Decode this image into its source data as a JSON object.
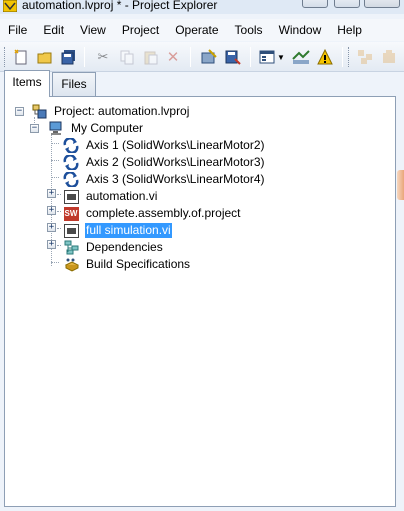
{
  "window": {
    "title": "automation.lvproj * - Project Explorer"
  },
  "menu": [
    "File",
    "Edit",
    "View",
    "Project",
    "Operate",
    "Tools",
    "Window",
    "Help"
  ],
  "toolbar": {
    "icons": [
      "new-icon",
      "open-icon",
      "save-all-icon",
      "cut-icon",
      "copy-icon",
      "paste-icon",
      "delete-icon",
      "build-icon",
      "save-build-icon",
      "view-icon",
      "dropdown-icon",
      "filter-icon",
      "warning-icon",
      "collapse-icon",
      "expand-icon"
    ]
  },
  "tabs": [
    {
      "label": "Items",
      "active": true
    },
    {
      "label": "Files",
      "active": false
    }
  ],
  "tree": {
    "project": "Project: automation.lvproj",
    "computer": "My Computer",
    "items": [
      {
        "label": "Axis 1 (SolidWorks\\LinearMotor2)",
        "icon": "axis-icon"
      },
      {
        "label": "Axis 2 (SolidWorks\\LinearMotor3)",
        "icon": "axis-icon"
      },
      {
        "label": "Axis 3 (SolidWorks\\LinearMotor4)",
        "icon": "axis-icon"
      },
      {
        "label": "automation.vi",
        "icon": "vi-icon"
      },
      {
        "label": "complete.assembly.of.project",
        "icon": "solidworks-icon"
      },
      {
        "label": "full simulation.vi",
        "icon": "vi-icon",
        "selected": true
      },
      {
        "label": "Dependencies",
        "icon": "dependencies-icon"
      },
      {
        "label": "Build Specifications",
        "icon": "build-specifications-icon"
      }
    ]
  }
}
